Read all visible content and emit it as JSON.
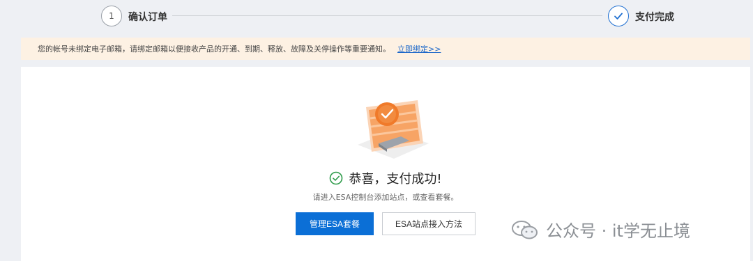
{
  "steps": {
    "step1_number": "1",
    "step1_label": "确认订单",
    "step2_label": "支付完成"
  },
  "notice": {
    "text": "您的帐号未绑定电子邮箱，请绑定邮箱以便接收产品的开通、到期、释放、故障及关停操作等重要通知。",
    "link": "立即绑定>>"
  },
  "result": {
    "title": "恭喜，支付成功!",
    "subtitle": "请进入ESA控制台添加站点，或查看套餐。",
    "primary_button": "管理ESA套餐",
    "secondary_button": "ESA站点接入方法"
  },
  "watermark": {
    "text": "公众号 · it学无止境"
  },
  "colors": {
    "accent": "#0b6fd6",
    "success": "#2e9b4a",
    "notice_bg": "#fdf1e3",
    "illustration_orange": "#f07a2a"
  }
}
